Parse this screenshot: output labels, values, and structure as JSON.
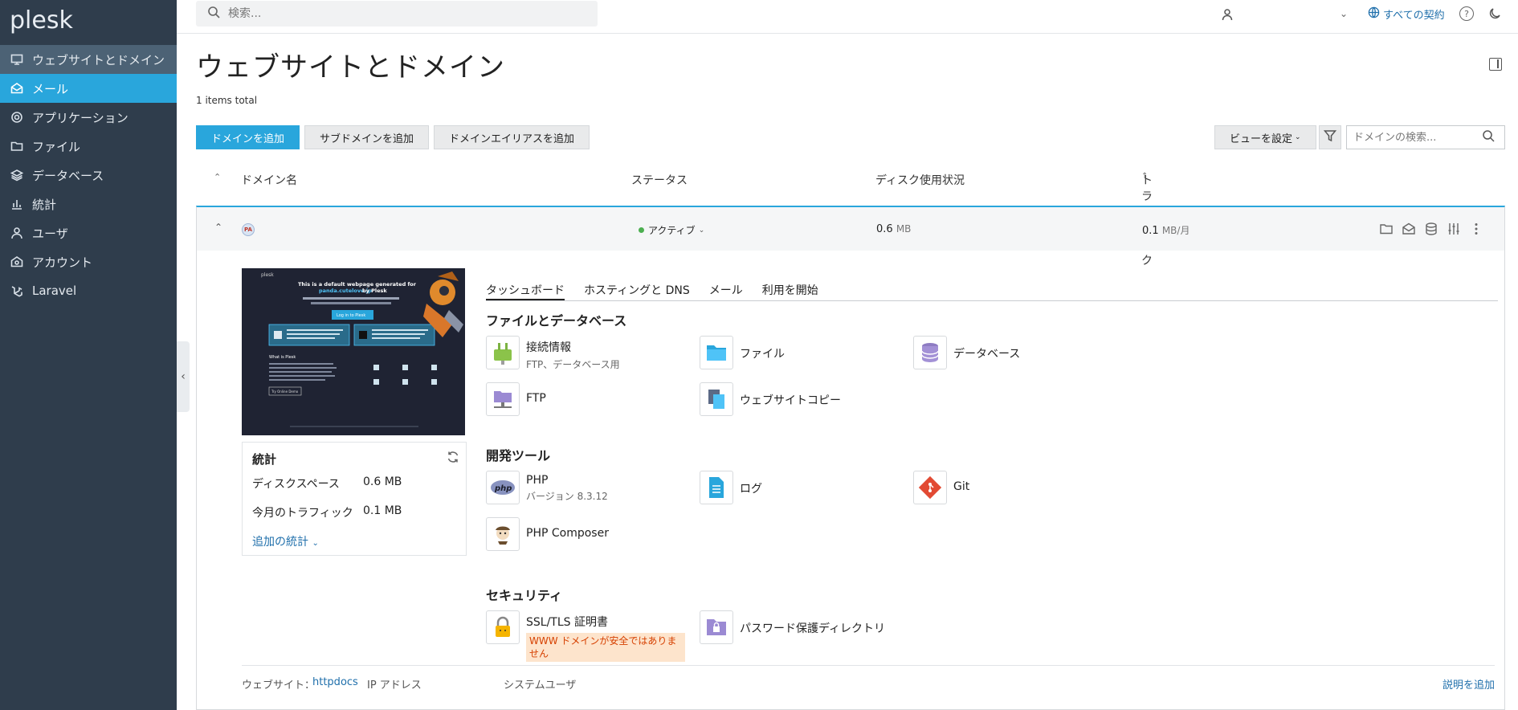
{
  "brand": {
    "name": "plesk"
  },
  "sidebar": {
    "items": [
      {
        "label": "ウェブサイトとドメイン",
        "icon": "monitor-icon"
      },
      {
        "label": "メール",
        "icon": "mail-icon"
      },
      {
        "label": "アプリケーション",
        "icon": "gear-icon"
      },
      {
        "label": "ファイル",
        "icon": "folder-icon"
      },
      {
        "label": "データベース",
        "icon": "layers-icon"
      },
      {
        "label": "統計",
        "icon": "bar-chart-icon"
      },
      {
        "label": "ユーザ",
        "icon": "user-icon"
      },
      {
        "label": "アカウント",
        "icon": "account-icon"
      },
      {
        "label": "Laravel",
        "icon": "laravel-icon"
      }
    ]
  },
  "topbar": {
    "search_placeholder": "検索...",
    "all_subscriptions": "すべての契約",
    "help": "?"
  },
  "page": {
    "title": "ウェブサイトとドメイン",
    "items_total": "1 items total"
  },
  "toolbar": {
    "add_domain": "ドメインを追加",
    "add_subdomain": "サブドメインを追加",
    "add_alias": "ドメインエイリアスを追加",
    "view_settings": "ビューを設定",
    "domain_search_placeholder": "ドメインの検索..."
  },
  "list": {
    "columns": {
      "name": "ドメイン名",
      "status": "ステータス",
      "disk": "ディスク使用状況",
      "traffic": "トラフィック"
    },
    "domain": {
      "avatar": "PA",
      "status": "アクティブ",
      "disk_value": "0.6",
      "disk_unit": "MB",
      "traffic_value": "0.1",
      "traffic_unit": "MB/月"
    }
  },
  "preview": {
    "headline": "This is a default webpage generated for",
    "domain": "panda.cutelove.jp",
    "by": "by Plesk",
    "login_button": "Log in to Plesk",
    "what_is": "What is Plesk",
    "try_button": "Try Online Demo"
  },
  "stats": {
    "title": "統計",
    "disk_label": "ディスクスペース",
    "disk_value": "0.6 MB",
    "traffic_label": "今月のトラフィック",
    "traffic_value": "0.1 MB",
    "more": "追加の統計"
  },
  "tabs": [
    "タッシュボード",
    "ホスティングと DNS",
    "メール",
    "利用を開始"
  ],
  "sections": {
    "files_db": {
      "title": "ファイルとデータベース",
      "connection": "接続情報",
      "connection_sub": "FTP、データベース用",
      "files": "ファイル",
      "databases": "データベース",
      "ftp": "FTP",
      "site_copy": "ウェブサイトコピー"
    },
    "dev": {
      "title": "開発ツール",
      "php": "PHP",
      "php_sub": "バージョン 8.3.12",
      "logs": "ログ",
      "git": "Git",
      "composer": "PHP Composer"
    },
    "security": {
      "title": "セキュリティ",
      "ssl": "SSL/TLS 証明書",
      "ssl_warning": "WWW ドメインが安全ではありません",
      "password_dirs": "パスワード保護ディレクトリ"
    }
  },
  "footer": {
    "website_label": "ウェブサイト：",
    "website_value": "httpdocs",
    "ip_label": "IP アドレス",
    "system_user_label": "システムユーザ",
    "add_description": "説明を追加"
  },
  "colors": {
    "sidebar_bg": "#2f3d4c",
    "accent": "#29a6dc",
    "link": "#1f6fab",
    "active_dot": "#4caf50",
    "warning_bg": "#fde4cc",
    "warning_text": "#d64000"
  }
}
